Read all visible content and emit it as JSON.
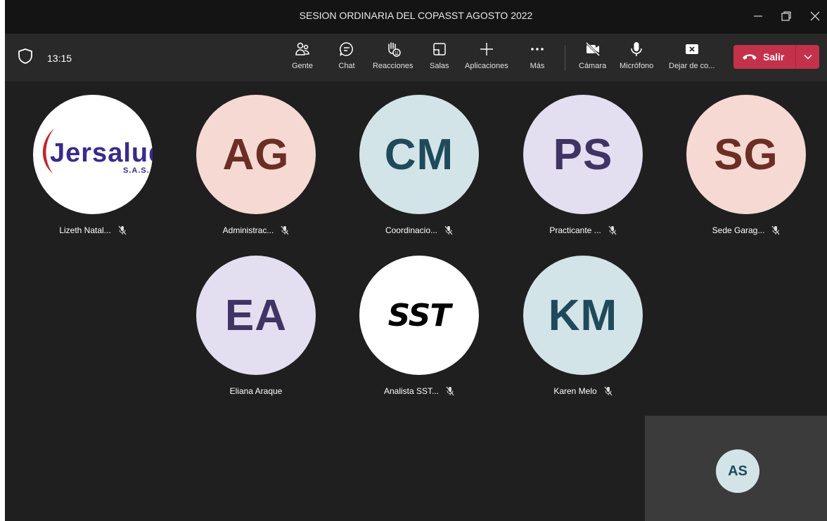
{
  "window": {
    "title": "SESION ORDINARIA DEL COPASST AGOSTO 2022"
  },
  "toolbar": {
    "time": "13:15",
    "gente": "Gente",
    "chat": "Chat",
    "reacciones": "Reacciones",
    "salas": "Salas",
    "aplicaciones": "Aplicaciones",
    "mas": "Más",
    "camara": "Cámara",
    "microfono": "Micrófono",
    "dejar": "Dejar de co...",
    "salir": "Salir"
  },
  "participants": [
    {
      "name": "Lizeth Natal...",
      "logo_text": "Jersalud",
      "logo_sub": "S.A.S."
    },
    {
      "name": "Administrac...",
      "initials": "AG",
      "bg": "#f6d9d3",
      "fg": "#6b2e24"
    },
    {
      "name": "Coordinacio...",
      "initials": "CM",
      "bg": "#d3e4e9",
      "fg": "#1f4a5a"
    },
    {
      "name": "Practicante ...",
      "initials": "PS",
      "bg": "#e3dff0",
      "fg": "#3f3463"
    },
    {
      "name": "Sede Garag...",
      "initials": "SG",
      "bg": "#f6d9d3",
      "fg": "#6b2e24"
    },
    {
      "name": "Eliana Araque",
      "initials": "EA",
      "bg": "#e3dff0",
      "fg": "#3f3463"
    },
    {
      "name": "Analista SST...",
      "logo_text": "SST"
    },
    {
      "name": "Karen Melo",
      "initials": "KM",
      "bg": "#d3e4e9",
      "fg": "#1f4a5a"
    }
  ],
  "self": {
    "initials": "AS"
  },
  "colors": {
    "leave": "#c4314b",
    "toolbar": "#292929",
    "titlebar": "#141414",
    "stage": "#1f1f1f"
  }
}
